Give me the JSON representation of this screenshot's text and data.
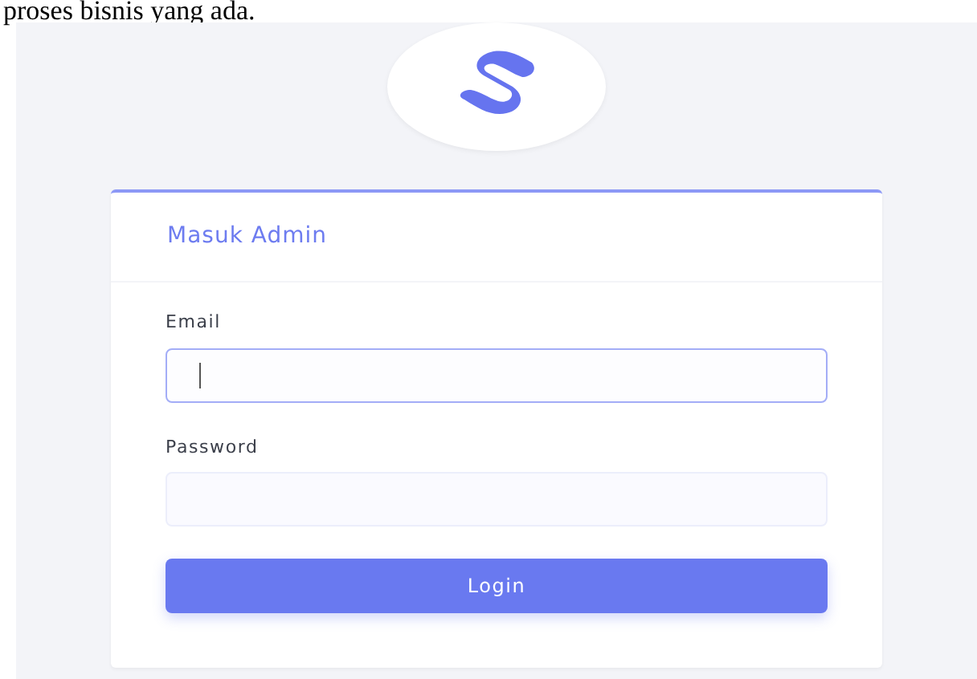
{
  "document_text": "proses bisnis yang ada.",
  "login": {
    "title": "Masuk Admin",
    "fields": [
      {
        "label": "Email",
        "focused": true
      },
      {
        "label": "Password",
        "focused": false
      }
    ],
    "button": "Login"
  }
}
